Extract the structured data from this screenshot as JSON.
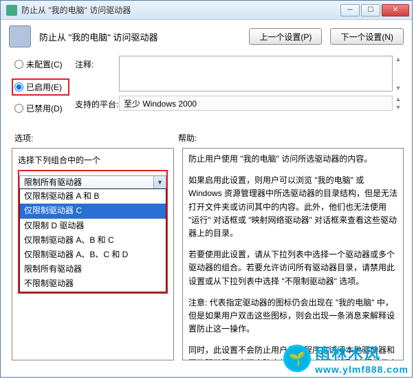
{
  "titlebar": {
    "title": "防止从 \"我的电脑\" 访问驱动器"
  },
  "header": {
    "title": "防止从 \"我的电脑\" 访问驱动器",
    "prev_btn": "上一个设置(P)",
    "next_btn": "下一个设置(N)"
  },
  "radios": {
    "not_configured": "未配置(C)",
    "enabled": "已启用(E)",
    "disabled": "已禁用(D)",
    "selected": "enabled"
  },
  "form": {
    "comment_label": "注释:",
    "comment_value": "",
    "platform_label": "支持的平台:",
    "platform_value": "至少 Windows 2000"
  },
  "sections": {
    "options_label": "选项:",
    "help_label": "帮助:"
  },
  "options_panel": {
    "prompt": "选择下列组合中的一个",
    "combo_value": "限制所有驱动器",
    "list": [
      "仅限制驱动器 A 和 B",
      "仅限制驱动器 C",
      "仅限制 D 驱动器",
      "仅限制驱动器 A、B 和 C",
      "仅限制驱动器 A、B、C 和 D",
      "限制所有驱动器",
      "不限制驱动器"
    ],
    "selected_index": 1
  },
  "help": {
    "p1": "防止用户使用 \"我的电脑\" 访问所选驱动器的内容。",
    "p2": "如果启用此设置，则用户可以浏览 \"我的电脑\" 或 Windows 资源管理器中所选驱动器的目录结构，但是无法打开文件夹或访问其中的内容。此外，他们也无法使用 \"运行\" 对话框或 \"映射网络驱动器\" 对话框来查看这些驱动器上的目录。",
    "p3": "若要使用此设置，请从下拉列表中选择一个驱动器或多个驱动器的组合。若要允许访问所有驱动器目录，请禁用此设置或从下拉列表中选择 \"不限制驱动器\" 选项。",
    "p4": "注意: 代表指定驱动器的图标仍会出现在 \"我的电脑\" 中，但是如果用户双击这些图标，则会出现一条消息来解释设置防止这一操作。",
    "p5": "同时，此设置不会防止用户使用程序来访问本地驱动器和网络驱动器，也不会防止他们使用 \"磁盘管理\" 管理单元查看并更改驱动器特性。"
  },
  "watermark": {
    "brand": "雨林木风",
    "url": "www.ylmf888.com"
  }
}
